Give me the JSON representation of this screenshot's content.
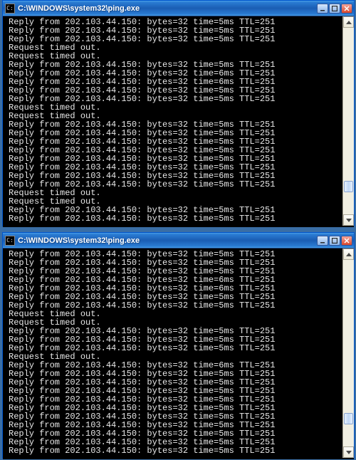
{
  "windows": [
    {
      "id": "win1",
      "title": "C:\\WINDOWS\\system32\\ping.exe",
      "icon_label": "cmd-icon",
      "lines": [
        "Reply from 202.103.44.150: bytes=32 time=5ms TTL=251",
        "Reply from 202.103.44.150: bytes=32 time=5ms TTL=251",
        "Reply from 202.103.44.150: bytes=32 time=5ms TTL=251",
        "Request timed out.",
        "Request timed out.",
        "Reply from 202.103.44.150: bytes=32 time=5ms TTL=251",
        "Reply from 202.103.44.150: bytes=32 time=6ms TTL=251",
        "Reply from 202.103.44.150: bytes=32 time=6ms TTL=251",
        "Reply from 202.103.44.150: bytes=32 time=5ms TTL=251",
        "Reply from 202.103.44.150: bytes=32 time=5ms TTL=251",
        "Request timed out.",
        "Request timed out.",
        "Reply from 202.103.44.150: bytes=32 time=5ms TTL=251",
        "Reply from 202.103.44.150: bytes=32 time=5ms TTL=251",
        "Reply from 202.103.44.150: bytes=32 time=5ms TTL=251",
        "Reply from 202.103.44.150: bytes=32 time=5ms TTL=251",
        "Reply from 202.103.44.150: bytes=32 time=5ms TTL=251",
        "Reply from 202.103.44.150: bytes=32 time=5ms TTL=251",
        "Reply from 202.103.44.150: bytes=32 time=6ms TTL=251",
        "Reply from 202.103.44.150: bytes=32 time=5ms TTL=251",
        "Request timed out.",
        "Request timed out.",
        "Reply from 202.103.44.150: bytes=32 time=5ms TTL=251",
        "Reply from 202.103.44.150: bytes=32 time=5ms TTL=251"
      ]
    },
    {
      "id": "win2",
      "title": "C:\\WINDOWS\\system32\\ping.exe",
      "icon_label": "cmd-icon",
      "lines": [
        "Reply from 202.103.44.150: bytes=32 time=5ms TTL=251",
        "Reply from 202.103.44.150: bytes=32 time=5ms TTL=251",
        "Reply from 202.103.44.150: bytes=32 time=5ms TTL=251",
        "Reply from 202.103.44.150: bytes=32 time=6ms TTL=251",
        "Reply from 202.103.44.150: bytes=32 time=6ms TTL=251",
        "Reply from 202.103.44.150: bytes=32 time=5ms TTL=251",
        "Reply from 202.103.44.150: bytes=32 time=5ms TTL=251",
        "Request timed out.",
        "Request timed out.",
        "Reply from 202.103.44.150: bytes=32 time=5ms TTL=251",
        "Reply from 202.103.44.150: bytes=32 time=5ms TTL=251",
        "Reply from 202.103.44.150: bytes=32 time=5ms TTL=251",
        "Request timed out.",
        "Reply from 202.103.44.150: bytes=32 time=6ms TTL=251",
        "Reply from 202.103.44.150: bytes=32 time=5ms TTL=251",
        "Reply from 202.103.44.150: bytes=32 time=5ms TTL=251",
        "Reply from 202.103.44.150: bytes=32 time=5ms TTL=251",
        "Reply from 202.103.44.150: bytes=32 time=5ms TTL=251",
        "Reply from 202.103.44.150: bytes=32 time=5ms TTL=251",
        "Reply from 202.103.44.150: bytes=32 time=5ms TTL=251",
        "Reply from 202.103.44.150: bytes=32 time=5ms TTL=251",
        "Reply from 202.103.44.150: bytes=32 time=5ms TTL=251",
        "Reply from 202.103.44.150: bytes=32 time=5ms TTL=251",
        "Reply from 202.103.44.150: bytes=32 time=5ms TTL=251"
      ]
    }
  ],
  "buttons": {
    "minimize_label": "Minimize",
    "maximize_label": "Maximize",
    "close_label": "Close"
  }
}
